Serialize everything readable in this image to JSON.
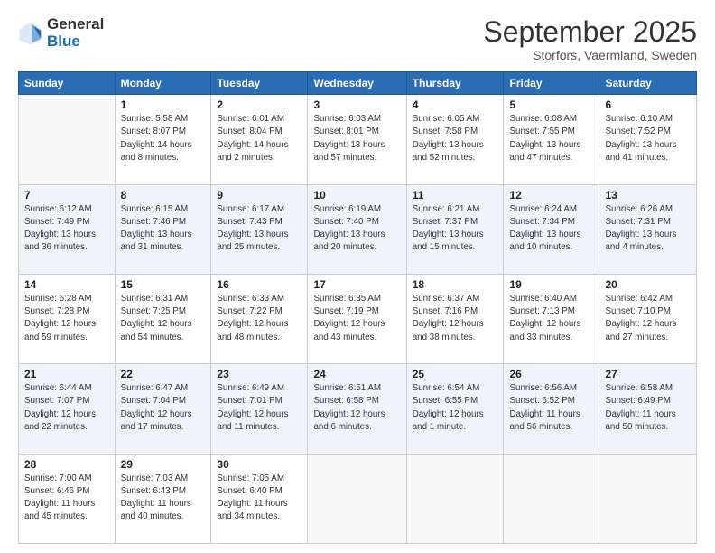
{
  "logo": {
    "general": "General",
    "blue": "Blue"
  },
  "title": "September 2025",
  "subtitle": "Storfors, Vaermland, Sweden",
  "weekdays": [
    "Sunday",
    "Monday",
    "Tuesday",
    "Wednesday",
    "Thursday",
    "Friday",
    "Saturday"
  ],
  "weeks": [
    [
      {
        "day": "",
        "sunrise": "",
        "sunset": "",
        "daylight": ""
      },
      {
        "day": "1",
        "sunrise": "Sunrise: 5:58 AM",
        "sunset": "Sunset: 8:07 PM",
        "daylight": "Daylight: 14 hours and 8 minutes."
      },
      {
        "day": "2",
        "sunrise": "Sunrise: 6:01 AM",
        "sunset": "Sunset: 8:04 PM",
        "daylight": "Daylight: 14 hours and 2 minutes."
      },
      {
        "day": "3",
        "sunrise": "Sunrise: 6:03 AM",
        "sunset": "Sunset: 8:01 PM",
        "daylight": "Daylight: 13 hours and 57 minutes."
      },
      {
        "day": "4",
        "sunrise": "Sunrise: 6:05 AM",
        "sunset": "Sunset: 7:58 PM",
        "daylight": "Daylight: 13 hours and 52 minutes."
      },
      {
        "day": "5",
        "sunrise": "Sunrise: 6:08 AM",
        "sunset": "Sunset: 7:55 PM",
        "daylight": "Daylight: 13 hours and 47 minutes."
      },
      {
        "day": "6",
        "sunrise": "Sunrise: 6:10 AM",
        "sunset": "Sunset: 7:52 PM",
        "daylight": "Daylight: 13 hours and 41 minutes."
      }
    ],
    [
      {
        "day": "7",
        "sunrise": "Sunrise: 6:12 AM",
        "sunset": "Sunset: 7:49 PM",
        "daylight": "Daylight: 13 hours and 36 minutes."
      },
      {
        "day": "8",
        "sunrise": "Sunrise: 6:15 AM",
        "sunset": "Sunset: 7:46 PM",
        "daylight": "Daylight: 13 hours and 31 minutes."
      },
      {
        "day": "9",
        "sunrise": "Sunrise: 6:17 AM",
        "sunset": "Sunset: 7:43 PM",
        "daylight": "Daylight: 13 hours and 25 minutes."
      },
      {
        "day": "10",
        "sunrise": "Sunrise: 6:19 AM",
        "sunset": "Sunset: 7:40 PM",
        "daylight": "Daylight: 13 hours and 20 minutes."
      },
      {
        "day": "11",
        "sunrise": "Sunrise: 6:21 AM",
        "sunset": "Sunset: 7:37 PM",
        "daylight": "Daylight: 13 hours and 15 minutes."
      },
      {
        "day": "12",
        "sunrise": "Sunrise: 6:24 AM",
        "sunset": "Sunset: 7:34 PM",
        "daylight": "Daylight: 13 hours and 10 minutes."
      },
      {
        "day": "13",
        "sunrise": "Sunrise: 6:26 AM",
        "sunset": "Sunset: 7:31 PM",
        "daylight": "Daylight: 13 hours and 4 minutes."
      }
    ],
    [
      {
        "day": "14",
        "sunrise": "Sunrise: 6:28 AM",
        "sunset": "Sunset: 7:28 PM",
        "daylight": "Daylight: 12 hours and 59 minutes."
      },
      {
        "day": "15",
        "sunrise": "Sunrise: 6:31 AM",
        "sunset": "Sunset: 7:25 PM",
        "daylight": "Daylight: 12 hours and 54 minutes."
      },
      {
        "day": "16",
        "sunrise": "Sunrise: 6:33 AM",
        "sunset": "Sunset: 7:22 PM",
        "daylight": "Daylight: 12 hours and 48 minutes."
      },
      {
        "day": "17",
        "sunrise": "Sunrise: 6:35 AM",
        "sunset": "Sunset: 7:19 PM",
        "daylight": "Daylight: 12 hours and 43 minutes."
      },
      {
        "day": "18",
        "sunrise": "Sunrise: 6:37 AM",
        "sunset": "Sunset: 7:16 PM",
        "daylight": "Daylight: 12 hours and 38 minutes."
      },
      {
        "day": "19",
        "sunrise": "Sunrise: 6:40 AM",
        "sunset": "Sunset: 7:13 PM",
        "daylight": "Daylight: 12 hours and 33 minutes."
      },
      {
        "day": "20",
        "sunrise": "Sunrise: 6:42 AM",
        "sunset": "Sunset: 7:10 PM",
        "daylight": "Daylight: 12 hours and 27 minutes."
      }
    ],
    [
      {
        "day": "21",
        "sunrise": "Sunrise: 6:44 AM",
        "sunset": "Sunset: 7:07 PM",
        "daylight": "Daylight: 12 hours and 22 minutes."
      },
      {
        "day": "22",
        "sunrise": "Sunrise: 6:47 AM",
        "sunset": "Sunset: 7:04 PM",
        "daylight": "Daylight: 12 hours and 17 minutes."
      },
      {
        "day": "23",
        "sunrise": "Sunrise: 6:49 AM",
        "sunset": "Sunset: 7:01 PM",
        "daylight": "Daylight: 12 hours and 11 minutes."
      },
      {
        "day": "24",
        "sunrise": "Sunrise: 6:51 AM",
        "sunset": "Sunset: 6:58 PM",
        "daylight": "Daylight: 12 hours and 6 minutes."
      },
      {
        "day": "25",
        "sunrise": "Sunrise: 6:54 AM",
        "sunset": "Sunset: 6:55 PM",
        "daylight": "Daylight: 12 hours and 1 minute."
      },
      {
        "day": "26",
        "sunrise": "Sunrise: 6:56 AM",
        "sunset": "Sunset: 6:52 PM",
        "daylight": "Daylight: 11 hours and 56 minutes."
      },
      {
        "day": "27",
        "sunrise": "Sunrise: 6:58 AM",
        "sunset": "Sunset: 6:49 PM",
        "daylight": "Daylight: 11 hours and 50 minutes."
      }
    ],
    [
      {
        "day": "28",
        "sunrise": "Sunrise: 7:00 AM",
        "sunset": "Sunset: 6:46 PM",
        "daylight": "Daylight: 11 hours and 45 minutes."
      },
      {
        "day": "29",
        "sunrise": "Sunrise: 7:03 AM",
        "sunset": "Sunset: 6:43 PM",
        "daylight": "Daylight: 11 hours and 40 minutes."
      },
      {
        "day": "30",
        "sunrise": "Sunrise: 7:05 AM",
        "sunset": "Sunset: 6:40 PM",
        "daylight": "Daylight: 11 hours and 34 minutes."
      },
      {
        "day": "",
        "sunrise": "",
        "sunset": "",
        "daylight": ""
      },
      {
        "day": "",
        "sunrise": "",
        "sunset": "",
        "daylight": ""
      },
      {
        "day": "",
        "sunrise": "",
        "sunset": "",
        "daylight": ""
      },
      {
        "day": "",
        "sunrise": "",
        "sunset": "",
        "daylight": ""
      }
    ]
  ]
}
